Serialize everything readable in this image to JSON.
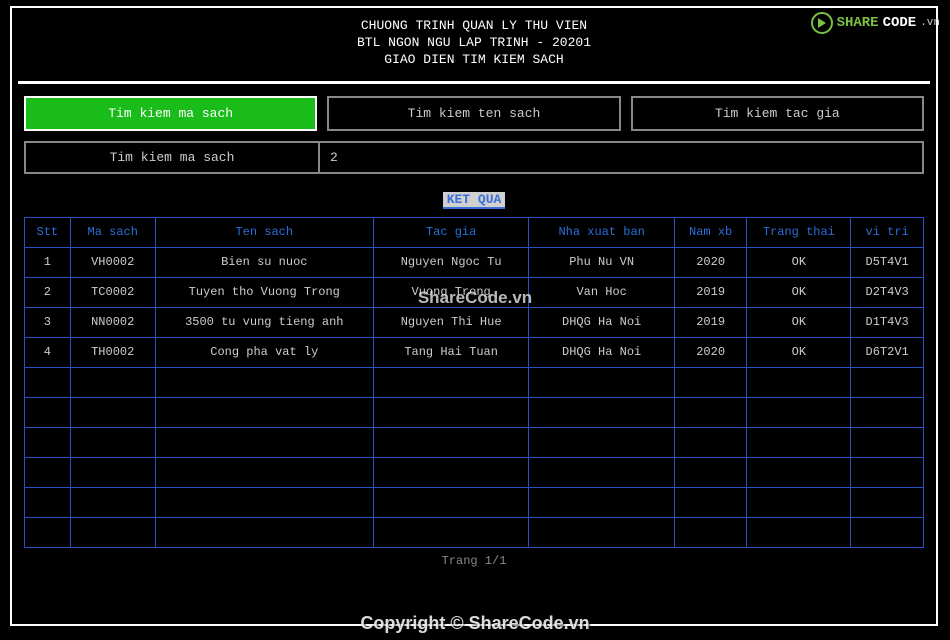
{
  "header": {
    "line1": "CHUONG TRINH QUAN LY THU VIEN",
    "line2": "BTL NGON NGU LAP TRINH - 20201",
    "line3": "GIAO DIEN TIM KIEM SACH"
  },
  "tabs": {
    "search_code": "Tim kiem ma sach",
    "search_name": "Tim kiem ten sach",
    "search_author": "Tim kiem tac gia"
  },
  "search": {
    "label": "Tim kiem ma sach",
    "value": "2"
  },
  "result_label": "KET QUA",
  "columns": {
    "stt": "Stt",
    "ma": "Ma sach",
    "ten": "Ten sach",
    "tg": "Tac gia",
    "nxb": "Nha xuat ban",
    "nam": "Nam xb",
    "tt": "Trang thai",
    "vt": "vi tri"
  },
  "rows": [
    {
      "stt": "1",
      "ma": "VH0002",
      "ten": "Bien su nuoc",
      "tg": "Nguyen Ngoc Tu",
      "nxb": "Phu Nu VN",
      "nam": "2020",
      "tt": "OK",
      "vt": "D5T4V1"
    },
    {
      "stt": "2",
      "ma": "TC0002",
      "ten": "Tuyen tho Vuong Trong",
      "tg": "Vuong Trong",
      "nxb": "Van Hoc",
      "nam": "2019",
      "tt": "OK",
      "vt": "D2T4V3"
    },
    {
      "stt": "3",
      "ma": "NN0002",
      "ten": "3500 tu vung tieng anh",
      "tg": "Nguyen Thi Hue",
      "nxb": "DHQG Ha Noi",
      "nam": "2019",
      "tt": "OK",
      "vt": "D1T4V3"
    },
    {
      "stt": "4",
      "ma": "TH0002",
      "ten": "Cong pha vat ly",
      "tg": "Tang Hai Tuan",
      "nxb": "DHQG Ha Noi",
      "nam": "2020",
      "tt": "OK",
      "vt": "D6T2V1"
    }
  ],
  "empty_rows": 6,
  "pager": "Trang 1/1",
  "watermark": {
    "logo_share": "SHARE",
    "logo_code": "CODE",
    "logo_vn": ".vn",
    "center": "ShareCode.vn",
    "bottom": "Copyright © ShareCode.vn"
  }
}
